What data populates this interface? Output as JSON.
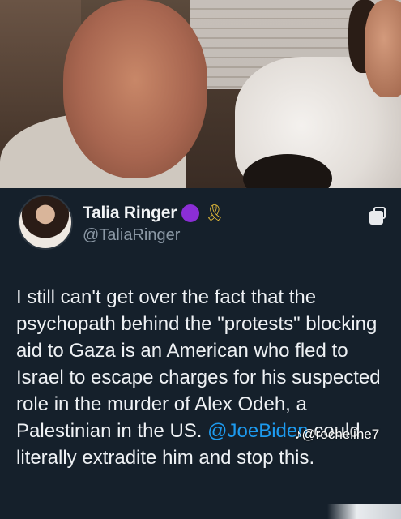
{
  "tweet": {
    "display_name": "Talia Ringer",
    "handle": "@TaliaRinger",
    "badge_color": "#8b2ed6",
    "ribbon_icon": "yellow-ribbon-icon",
    "copy_icon": "copy-icon",
    "text_part1": "I still can't get over the fact that the psychopath behind the \"protests\" blocking aid to Gaza is an American who fled to Israel to escape charges for his suspected role in the murder of Alex Odeh, a Palestinian in the US. ",
    "mention": "@JoeBiden",
    "text_part2": " could literally extradite him and stop this.",
    "mention_color": "#1d9bf0"
  },
  "overlay": {
    "watermark": "♪@rocheline7"
  }
}
